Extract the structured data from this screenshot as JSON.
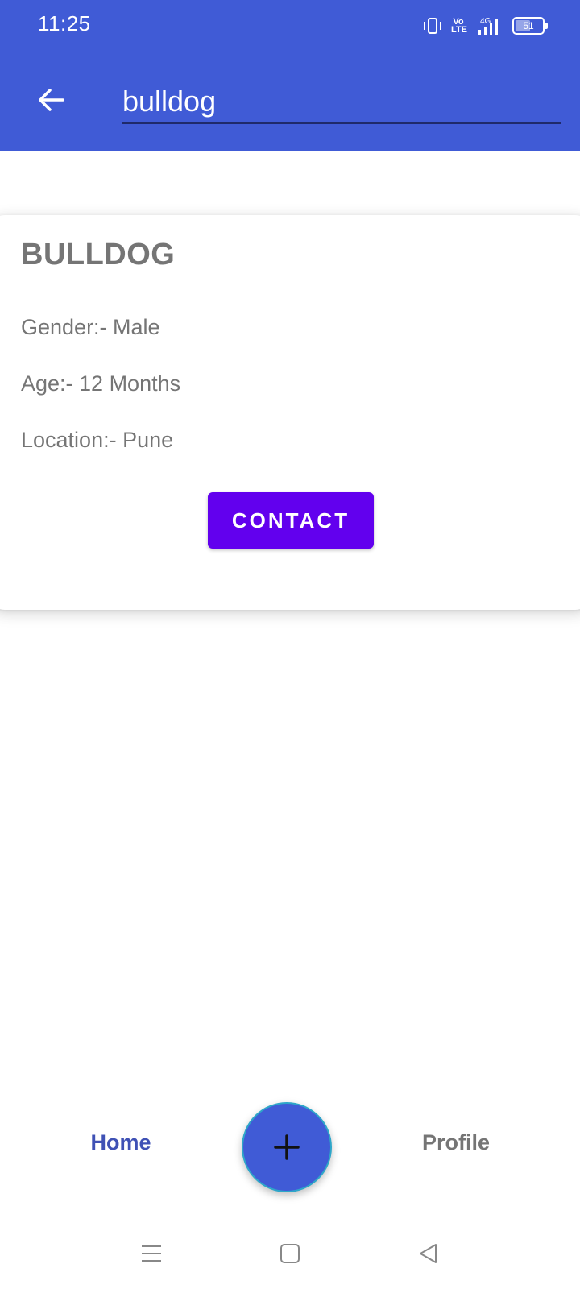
{
  "status_bar": {
    "time": "11:25",
    "volte_label": "Vo LTE",
    "network_label": "4G",
    "battery_level": "51"
  },
  "search": {
    "value": "bulldog",
    "placeholder": ""
  },
  "card": {
    "name": "BULLDOG",
    "gender": "Gender:- Male",
    "age": "Age:- 12 Months",
    "location": "Location:- Pune",
    "contact_label": "CONTACT"
  },
  "bottom_nav": {
    "home_label": "Home",
    "profile_label": "Profile",
    "fab_icon": "plus-icon"
  },
  "colors": {
    "app_bar": "#405BD6",
    "contact_button": "#6200EE",
    "nav_active": "#3F51B5",
    "text_secondary": "#757575"
  }
}
